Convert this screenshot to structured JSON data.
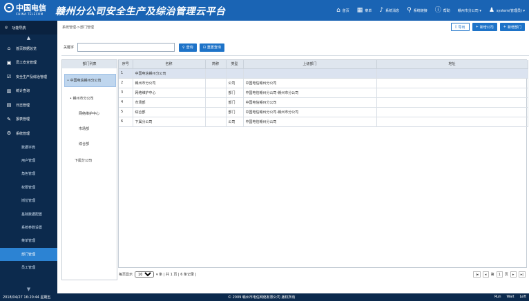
{
  "header": {
    "logo_cn": "中国电信",
    "logo_en": "CHINA TELECOM",
    "title": "赣州分公司安全生产及综治管理云平台",
    "nav": [
      {
        "icon": "home-icon",
        "glyph": "⌂",
        "label": "首页"
      },
      {
        "icon": "grid-icon",
        "glyph": "▦",
        "label": "菜单"
      },
      {
        "icon": "bell-icon",
        "glyph": "♪",
        "label": "系统消息"
      },
      {
        "icon": "link-icon",
        "glyph": "⚲",
        "label": "系统链接"
      },
      {
        "icon": "help-icon",
        "glyph": "ⓘ",
        "label": "帮助"
      },
      {
        "icon": "org-icon",
        "glyph": "",
        "label": "赣州市分公司 ▾"
      },
      {
        "icon": "user-icon",
        "glyph": "♟",
        "label": "system(管理员) ▾"
      }
    ]
  },
  "sidebar": {
    "head": "功能导航",
    "items": [
      {
        "icon": "⌂",
        "label": "首页数据总览"
      },
      {
        "icon": "▣",
        "label": "员工安全管理"
      },
      {
        "icon": "☑",
        "label": "安全生产及综治管理"
      },
      {
        "icon": "▥",
        "label": "统计查询"
      },
      {
        "icon": "▤",
        "label": "日志管理"
      },
      {
        "icon": "✎",
        "label": "报表管理"
      },
      {
        "icon": "⚙",
        "label": "系统管理"
      }
    ],
    "subitems": [
      {
        "label": "数据字典",
        "active": false
      },
      {
        "label": "用户管理",
        "active": false
      },
      {
        "label": "角色管理",
        "active": false
      },
      {
        "label": "权限管理",
        "active": false
      },
      {
        "label": "岗位管理",
        "active": false
      },
      {
        "label": "基础数据配置",
        "active": false
      },
      {
        "label": "系统参数设置",
        "active": false
      },
      {
        "label": "菜单管理",
        "active": false
      },
      {
        "label": "部门管理",
        "active": true
      },
      {
        "label": "员工管理",
        "active": false
      }
    ]
  },
  "breadcrumb": "系统管理->部门管理",
  "actions": [
    {
      "label": "导出",
      "style": "light",
      "icon": "export-icon"
    },
    {
      "label": "新增公司",
      "style": "solid",
      "icon": "plus-icon"
    },
    {
      "label": "新增部门",
      "style": "solid",
      "icon": "plus-icon"
    }
  ],
  "search": {
    "label": "关键字",
    "value": "",
    "placeholder": "",
    "search_button": "查询",
    "clear_button": "重置查询"
  },
  "tree": {
    "header": "部门列表",
    "nodes": [
      {
        "label": "• 中国电信赣州分公司",
        "selected": true
      },
      {
        "label": "• 赣州市分公司",
        "selected": false
      },
      {
        "label": "网络维护中心",
        "selected": false
      },
      {
        "label": "市场部",
        "selected": false
      },
      {
        "label": "综合部",
        "selected": false
      },
      {
        "label": "下属分公司",
        "selected": false
      }
    ]
  },
  "grid": {
    "columns": [
      "序号",
      "名称",
      "简称",
      "类型",
      "上级部门",
      "地址"
    ],
    "rows": [
      {
        "no": "1",
        "name": "中国电信赣州分公司",
        "short": "",
        "type": "",
        "parent": "",
        "address": ""
      },
      {
        "no": "2",
        "name": "赣州市分公司",
        "short": "",
        "type": "公司",
        "parent": "中国电信赣州分公司",
        "address": ""
      },
      {
        "no": "3",
        "name": "网络维护中心",
        "short": "",
        "type": "部门",
        "parent": "中国电信赣州分公司-赣州市分公司",
        "address": ""
      },
      {
        "no": "4",
        "name": "市场部",
        "short": "",
        "type": "部门",
        "parent": "中国电信赣州分公司",
        "address": ""
      },
      {
        "no": "5",
        "name": "综合部",
        "short": "",
        "type": "部门",
        "parent": "中国电信赣州分公司-赣州市分公司",
        "address": ""
      },
      {
        "no": "6",
        "name": "下属分公司",
        "short": "",
        "type": "公司",
        "parent": "中国电信赣州分公司",
        "address": ""
      }
    ]
  },
  "pager": {
    "per_page_label": "每页显示",
    "per_page": "10",
    "summary": "▾ 条 | 共 1 页 | 6 条记录 |",
    "page_label": "第",
    "page_value": "1",
    "page_suffix": "页"
  },
  "footer": {
    "datetime": "2018/04/27 16:20:44 星期五",
    "copyright": "© 2009 赣州市电信网络有限公司 版权所有",
    "stats": [
      "Run",
      "Wait",
      "Left"
    ]
  },
  "colors": {
    "topbar": "#1a64b4",
    "sidebar": "#0c2a4d",
    "accent": "#1e73c8",
    "active": "#2c83d3"
  }
}
